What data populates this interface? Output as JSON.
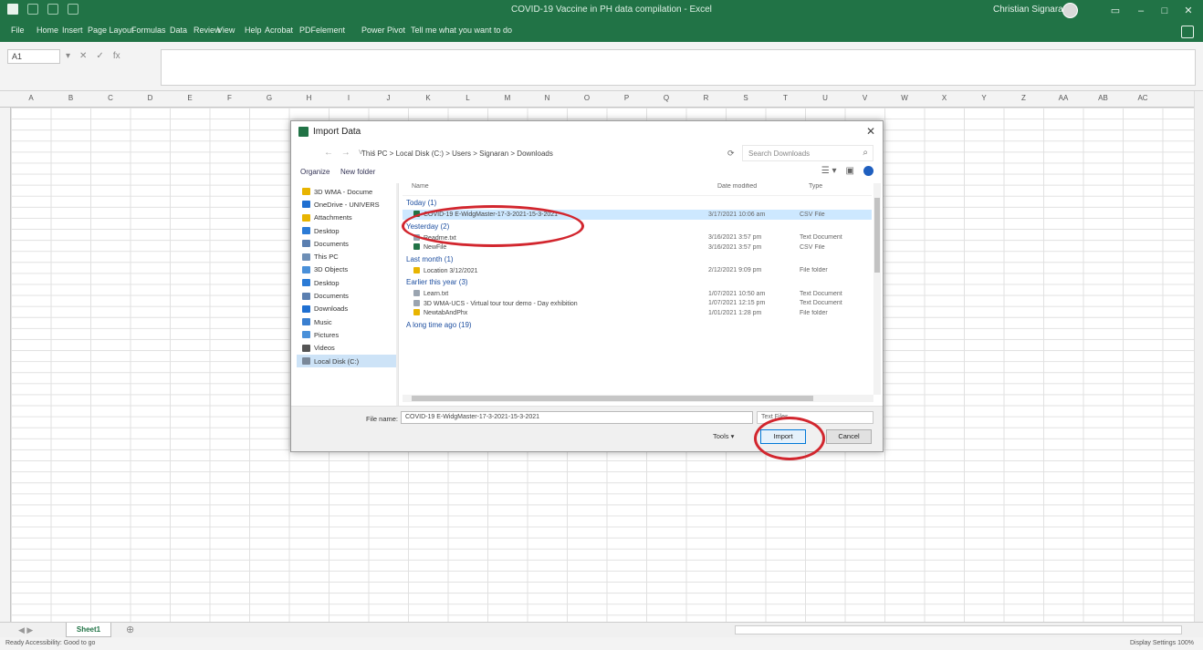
{
  "titlebar": {
    "doc_title": "COVID-19 Vaccine in PH data compilation - Excel",
    "user_name": "Christian Signaran"
  },
  "ribbon_tabs": [
    "File",
    "Home",
    "Insert",
    "Page Layout",
    "Formulas",
    "Data",
    "Review",
    "View",
    "Help",
    "Acrobat",
    "PDFelement",
    "Power Pivot",
    "Tell me what you want to do"
  ],
  "formula": {
    "cell_ref": "A1"
  },
  "columns": [
    "A",
    "B",
    "C",
    "D",
    "E",
    "F",
    "G",
    "H",
    "I",
    "J",
    "K",
    "L",
    "M",
    "N",
    "O",
    "P",
    "Q",
    "R",
    "S",
    "T",
    "U",
    "V",
    "W",
    "X",
    "Y",
    "Z",
    "AA",
    "AB",
    "AC"
  ],
  "dialog": {
    "title": "Import Data",
    "address": "This PC  >  Local Disk (C:)  >  Users  >  Signaran  >  Downloads",
    "search_placeholder": "Search Downloads",
    "organize": "Organize",
    "new_folder": "New folder",
    "nav_items": [
      "3D WMA - Docume",
      "OneDrive - UNIVERS",
      "Attachments",
      "Desktop",
      "Documents",
      "This PC",
      "3D Objects",
      "Desktop",
      "Documents",
      "Downloads",
      "Music",
      "Pictures",
      "Videos",
      "Local Disk (C:)"
    ],
    "columns": {
      "name": "Name",
      "date": "Date modified",
      "type": "Type"
    },
    "groups": [
      {
        "label": "Today (1)",
        "files": [
          {
            "name": "COVID-19 E-WidgMaster-17-3-2021-15-3-2021",
            "date": "3/17/2021 10:06 am",
            "type": "CSV File",
            "highlight": true
          }
        ]
      },
      {
        "label": "Yesterday (2)",
        "files": [
          {
            "name": "Readme.txt",
            "date": "3/16/2021 3:57 pm",
            "type": "Text Document",
            "highlight": false
          },
          {
            "name": "NewFile",
            "date": "3/16/2021 3:57 pm",
            "type": "CSV File",
            "highlight": false
          }
        ]
      },
      {
        "label": "Last month (1)",
        "files": [
          {
            "name": "Location 3/12/2021",
            "date": "2/12/2021 9:09 pm",
            "type": "File folder",
            "highlight": false
          }
        ]
      },
      {
        "label": "Earlier this year (3)",
        "files": [
          {
            "name": "Learn.txt",
            "date": "1/07/2021 10:50 am",
            "type": "Text Document",
            "highlight": false
          },
          {
            "name": "3D WMA-UCS - Virtual tour tour demo - Day exhibition",
            "date": "1/07/2021 12:15 pm",
            "type": "Text Document",
            "highlight": false
          },
          {
            "name": "NewtabAndPhx",
            "date": "1/01/2021 1:28 pm",
            "type": "File folder",
            "highlight": false
          }
        ]
      },
      {
        "label": "A long time ago (19)",
        "files": []
      }
    ],
    "file_name_label": "File name:",
    "file_name_value": "COVID-19 E-WidgMaster-17-3-2021-15-3-2021",
    "file_type": "Text Files",
    "tools": "Tools",
    "import": "Import",
    "cancel": "Cancel"
  },
  "sheet_tab": "Sheet1",
  "status": {
    "left": "Ready   Accessibility: Good to go",
    "right": "Display Settings    100%"
  },
  "colors": {
    "excel_green": "#217346",
    "annotation_red": "#d2262e",
    "selection_blue": "#cde8ff"
  }
}
